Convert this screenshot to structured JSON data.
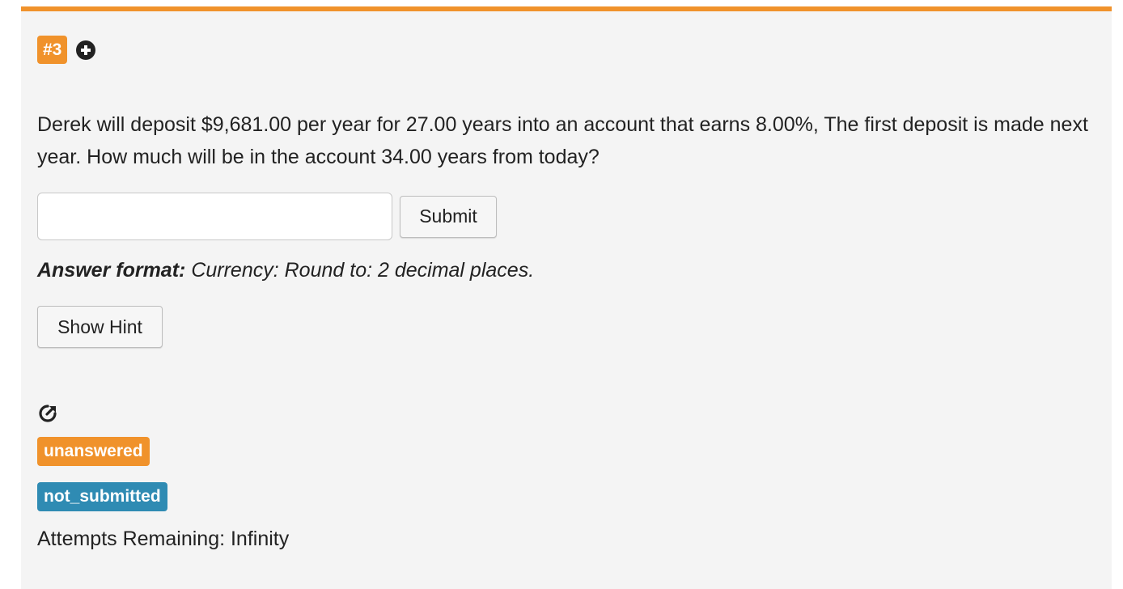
{
  "question": {
    "number_label": "#3",
    "text": "Derek will deposit $9,681.00 per year for 27.00 years into an account that earns 8.00%, The first deposit is made next year. How much will be in the account 34.00 years from today?"
  },
  "answer": {
    "input_value": "",
    "placeholder": "",
    "submit_label": "Submit"
  },
  "answer_format": {
    "label": "Answer format:",
    "value": " Currency: Round to: 2 decimal places."
  },
  "hint": {
    "button_label": "Show Hint"
  },
  "status": {
    "answered_badge": "unanswered",
    "submitted_badge": "not_submitted",
    "attempts_text": "Attempts Remaining: Infinity"
  },
  "icons": {
    "add": "plus-circle-icon",
    "share": "share-icon"
  },
  "colors": {
    "accent_orange": "#f0922b",
    "badge_blue": "#2f8bb3",
    "panel_bg": "#f4f4f4"
  }
}
